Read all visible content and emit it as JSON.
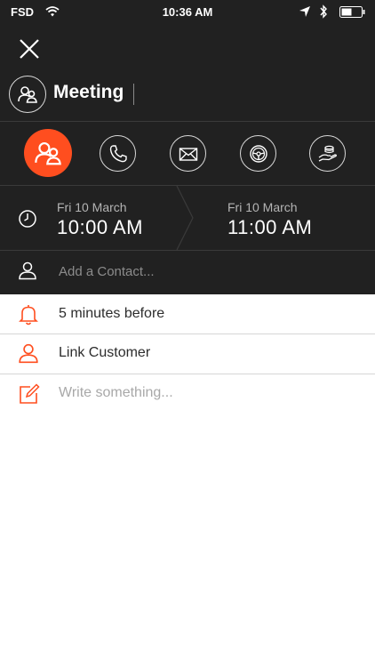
{
  "status_bar": {
    "carrier": "FSD",
    "time": "10:36 AM"
  },
  "header": {
    "title": "Meeting"
  },
  "event_types": [
    {
      "name": "meeting",
      "icon": "meeting-icon",
      "active": true
    },
    {
      "name": "call",
      "icon": "phone-icon",
      "active": false
    },
    {
      "name": "email",
      "icon": "mail-icon",
      "active": false
    },
    {
      "name": "drive",
      "icon": "steering-wheel-icon",
      "active": false
    },
    {
      "name": "payment",
      "icon": "coins-hand-icon",
      "active": false
    }
  ],
  "schedule": {
    "start": {
      "date": "Fri 10 March",
      "time": "10:00 AM"
    },
    "end": {
      "date": "Fri 10 March",
      "time": "11:00 AM"
    }
  },
  "contact": {
    "placeholder": "Add a Contact..."
  },
  "reminder": {
    "label": "5 minutes before"
  },
  "customer": {
    "label": "Link Customer"
  },
  "note": {
    "placeholder": "Write something..."
  },
  "colors": {
    "accent": "#ff4e1f",
    "dark_bg": "#212121",
    "light_bg": "#ffffff"
  }
}
